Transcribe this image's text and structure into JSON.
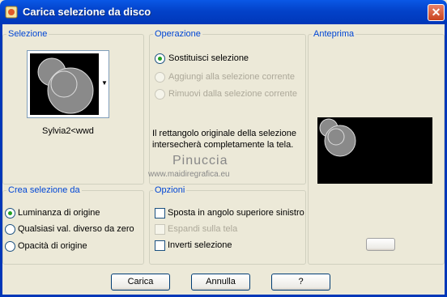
{
  "window": {
    "title": "Carica selezione da disco"
  },
  "selezione": {
    "label": "Selezione",
    "file_name": "Sylvia2<wwd"
  },
  "operazione": {
    "label": "Operazione",
    "options": [
      "Sostituisci selezione",
      "Aggiungi alla selezione corrente",
      "Rimuovi dalla selezione corrente"
    ],
    "selected": 0,
    "info_line1": "Il rettangolo originale della selezione",
    "info_line2": "intersecherà completamente la tela."
  },
  "anteprima": {
    "label": "Anteprima"
  },
  "crea": {
    "label": "Crea selezione da",
    "options": [
      "Luminanza di origine",
      "Qualsiasi val. diverso da zero",
      "Opacità di origine"
    ],
    "selected": 0
  },
  "opzioni": {
    "label": "Opzioni",
    "items": [
      "Sposta in angolo superiore sinistro",
      "Espandi sulla tela",
      "Inverti selezione"
    ],
    "checked": [
      false,
      false,
      false
    ],
    "disabled": [
      false,
      true,
      false
    ]
  },
  "watermark": {
    "line1": "Pinuccia",
    "line2": "www.maidiregrafica.eu"
  },
  "buttons": {
    "load": "Carica",
    "cancel": "Annulla",
    "help": "?"
  },
  "colors": {
    "title_bar": "#0342c9",
    "legend": "#0046d5",
    "radio_dot": "#21a121",
    "face": "#ece9d8"
  }
}
